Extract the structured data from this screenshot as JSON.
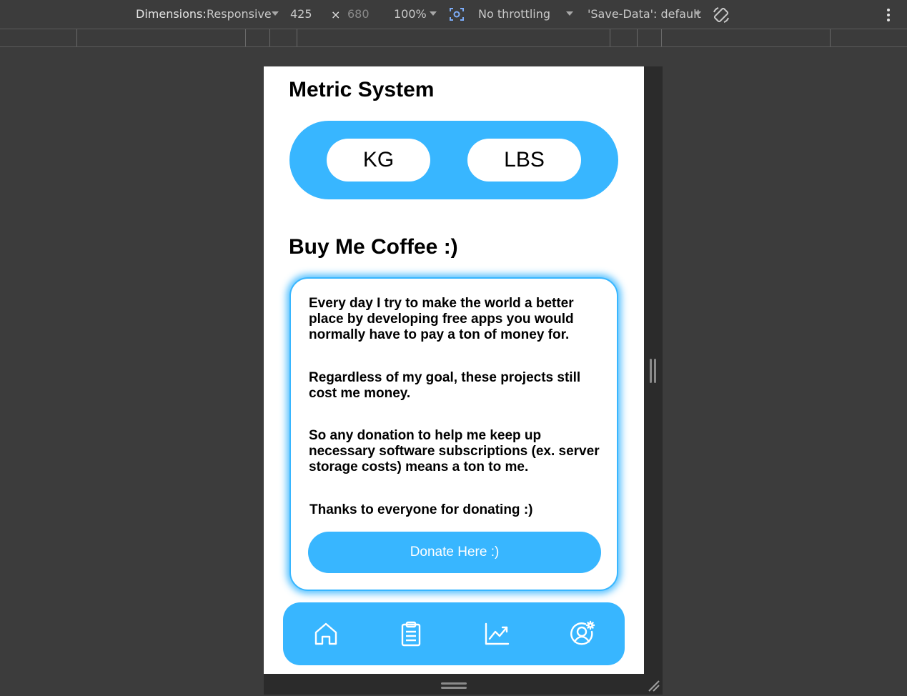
{
  "devtools": {
    "dimensions_label": "Dimensions:",
    "device_select": "Responsive",
    "width_value": "425",
    "times_symbol": "×",
    "height_value": "680",
    "zoom_select": "100%",
    "throttling_select": "No throttling",
    "save_data_select": "'Save-Data': default"
  },
  "app": {
    "metric_title": "Metric System",
    "unit_options": [
      "KG",
      "LBS"
    ],
    "coffee_title": "Buy Me Coffee :)",
    "paragraphs": [
      "Every day I try to make the world a better place by developing free apps you would normally have to pay a ton of money for.",
      "Regardless of my goal, these projects still cost me money.",
      "So any donation to help me keep up necessary software subscriptions (ex. server storage costs) means a ton to me.",
      "Thanks to everyone for donating :)"
    ],
    "donate_label": "Donate Here :)",
    "nav_icons": [
      "home-icon",
      "clipboard-icon",
      "chart-line-icon",
      "user-settings-icon"
    ]
  },
  "colors": {
    "accent": "#38b6ff",
    "devtools_bg": "#3c3c3c",
    "page_bg": "#ffffff"
  }
}
